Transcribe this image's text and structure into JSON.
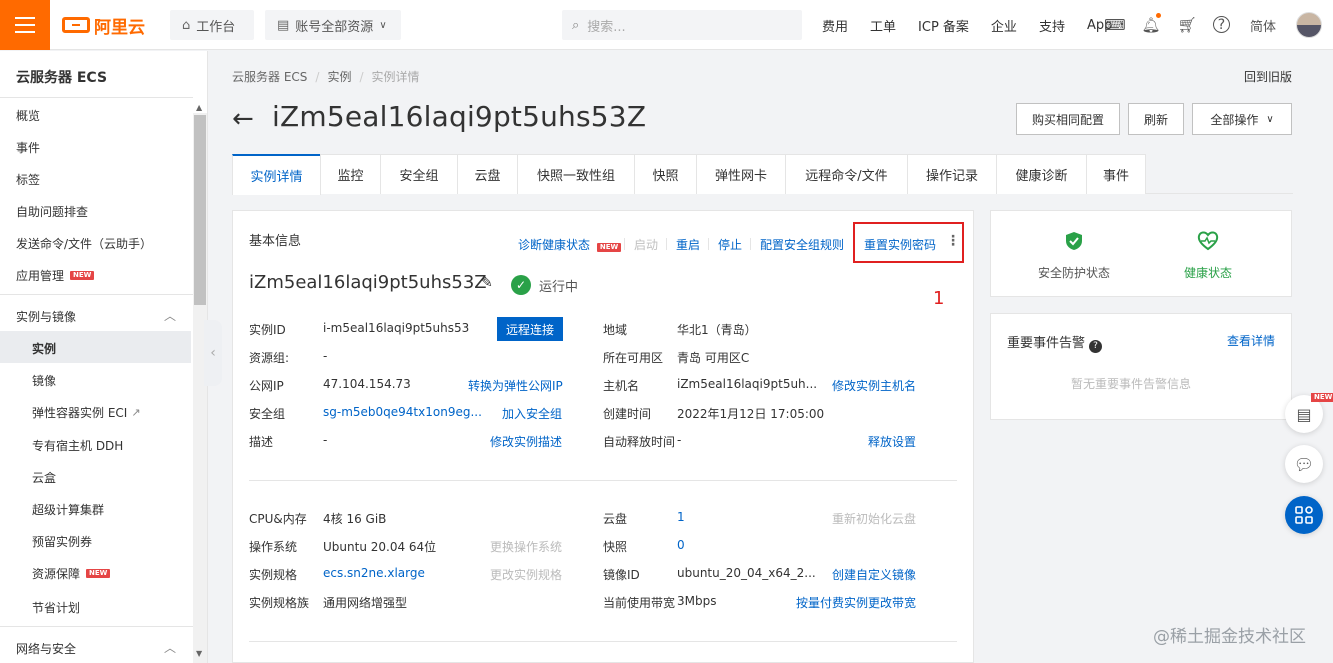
{
  "topbar": {
    "logo_text": "阿里云",
    "workbench": "工作台",
    "resources": "账号全部资源",
    "search_placeholder": "搜索...",
    "nav": [
      "费用",
      "工单",
      "ICP 备案",
      "企业",
      "支持",
      "App"
    ],
    "lang": "简体"
  },
  "sidebar": {
    "title": "云服务器 ECS",
    "items": [
      "概览",
      "事件",
      "标签",
      "自助问题排查",
      "发送命令/文件（云助手）",
      "应用管理"
    ],
    "group1": "实例与镜像",
    "group1_items": [
      "实例",
      "镜像",
      "弹性容器实例 ECI",
      "专有宿主机 DDH",
      "云盒",
      "超级计算集群",
      "预留实例券",
      "资源保障",
      "节省计划"
    ],
    "group2": "网络与安全",
    "new_badge": "NEW"
  },
  "breadcrumb": [
    "云服务器 ECS",
    "实例",
    "实例详情"
  ],
  "back_old": "回到旧版",
  "page_title": "iZm5eal16laqi9pt5uhs53Z",
  "buttons": {
    "buy_same": "购买相同配置",
    "refresh": "刷新",
    "all_ops": "全部操作"
  },
  "tabs": [
    "实例详情",
    "监控",
    "安全组",
    "云盘",
    "快照一致性组",
    "快照",
    "弹性网卡",
    "远程命令/文件",
    "操作记录",
    "健康诊断",
    "事件"
  ],
  "basic": {
    "title": "基本信息",
    "actions": {
      "diagnose": "诊断健康状态",
      "start": "启动",
      "restart": "重启",
      "stop": "停止",
      "config_sg": "配置安全组规则",
      "reset_pwd": "重置实例密码"
    },
    "annotation": "1",
    "instance_name": "iZm5eal16laqi9pt5uhs53Z",
    "status": "运行中",
    "rows_left": [
      {
        "label": "实例ID",
        "value": "i-m5eal16laqi9pt5uhs53",
        "link": "远程连接"
      },
      {
        "label": "资源组:",
        "value": "-",
        "link": ""
      },
      {
        "label": "公网IP",
        "value": "47.104.154.73",
        "link": "转换为弹性公网IP"
      },
      {
        "label": "安全组",
        "value": "sg-m5eb0qe94tx1on9eg...",
        "link": "加入安全组"
      },
      {
        "label": "描述",
        "value": "-",
        "link": "修改实例描述"
      }
    ],
    "rows_right": [
      {
        "label": "地域",
        "value": "华北1（青岛）",
        "link": ""
      },
      {
        "label": "所在可用区",
        "value": "青岛 可用区C",
        "link": ""
      },
      {
        "label": "主机名",
        "value": "iZm5eal16laqi9pt5uh...",
        "link": "修改实例主机名"
      },
      {
        "label": "创建时间",
        "value": "2022年1月12日 17:05:00",
        "link": ""
      },
      {
        "label": "自动释放时间",
        "value": "-",
        "link": "释放设置"
      }
    ],
    "config_left": [
      {
        "label": "CPU&内存",
        "value": "4核 16 GiB",
        "link": ""
      },
      {
        "label": "操作系统",
        "value": "Ubuntu 20.04 64位",
        "link": "更换操作系统"
      },
      {
        "label": "实例规格",
        "value": "ecs.sn2ne.xlarge",
        "link": "更改实例规格"
      },
      {
        "label": "实例规格族",
        "value": "通用网络增强型",
        "link": ""
      }
    ],
    "config_right": [
      {
        "label": "云盘",
        "value": "1",
        "link": "重新初始化云盘"
      },
      {
        "label": "快照",
        "value": "0",
        "link": ""
      },
      {
        "label": "镜像ID",
        "value": "ubuntu_20_04_x64_2...",
        "link": "创建自定义镜像"
      },
      {
        "label": "当前使用带宽",
        "value": "3Mbps",
        "link": "按量付费实例更改带宽"
      }
    ]
  },
  "health_card": {
    "security": "安全防护状态",
    "health": "健康状态"
  },
  "events_card": {
    "title": "重要事件告警",
    "link": "查看详情",
    "empty": "暂无重要事件告警信息"
  },
  "float_new": "NEW",
  "watermark": "@稀土掘金技术社区",
  "colors": {
    "brand": "#ff6a00",
    "link": "#0064c8",
    "success": "#2aa148",
    "annotation": "#e02020"
  }
}
